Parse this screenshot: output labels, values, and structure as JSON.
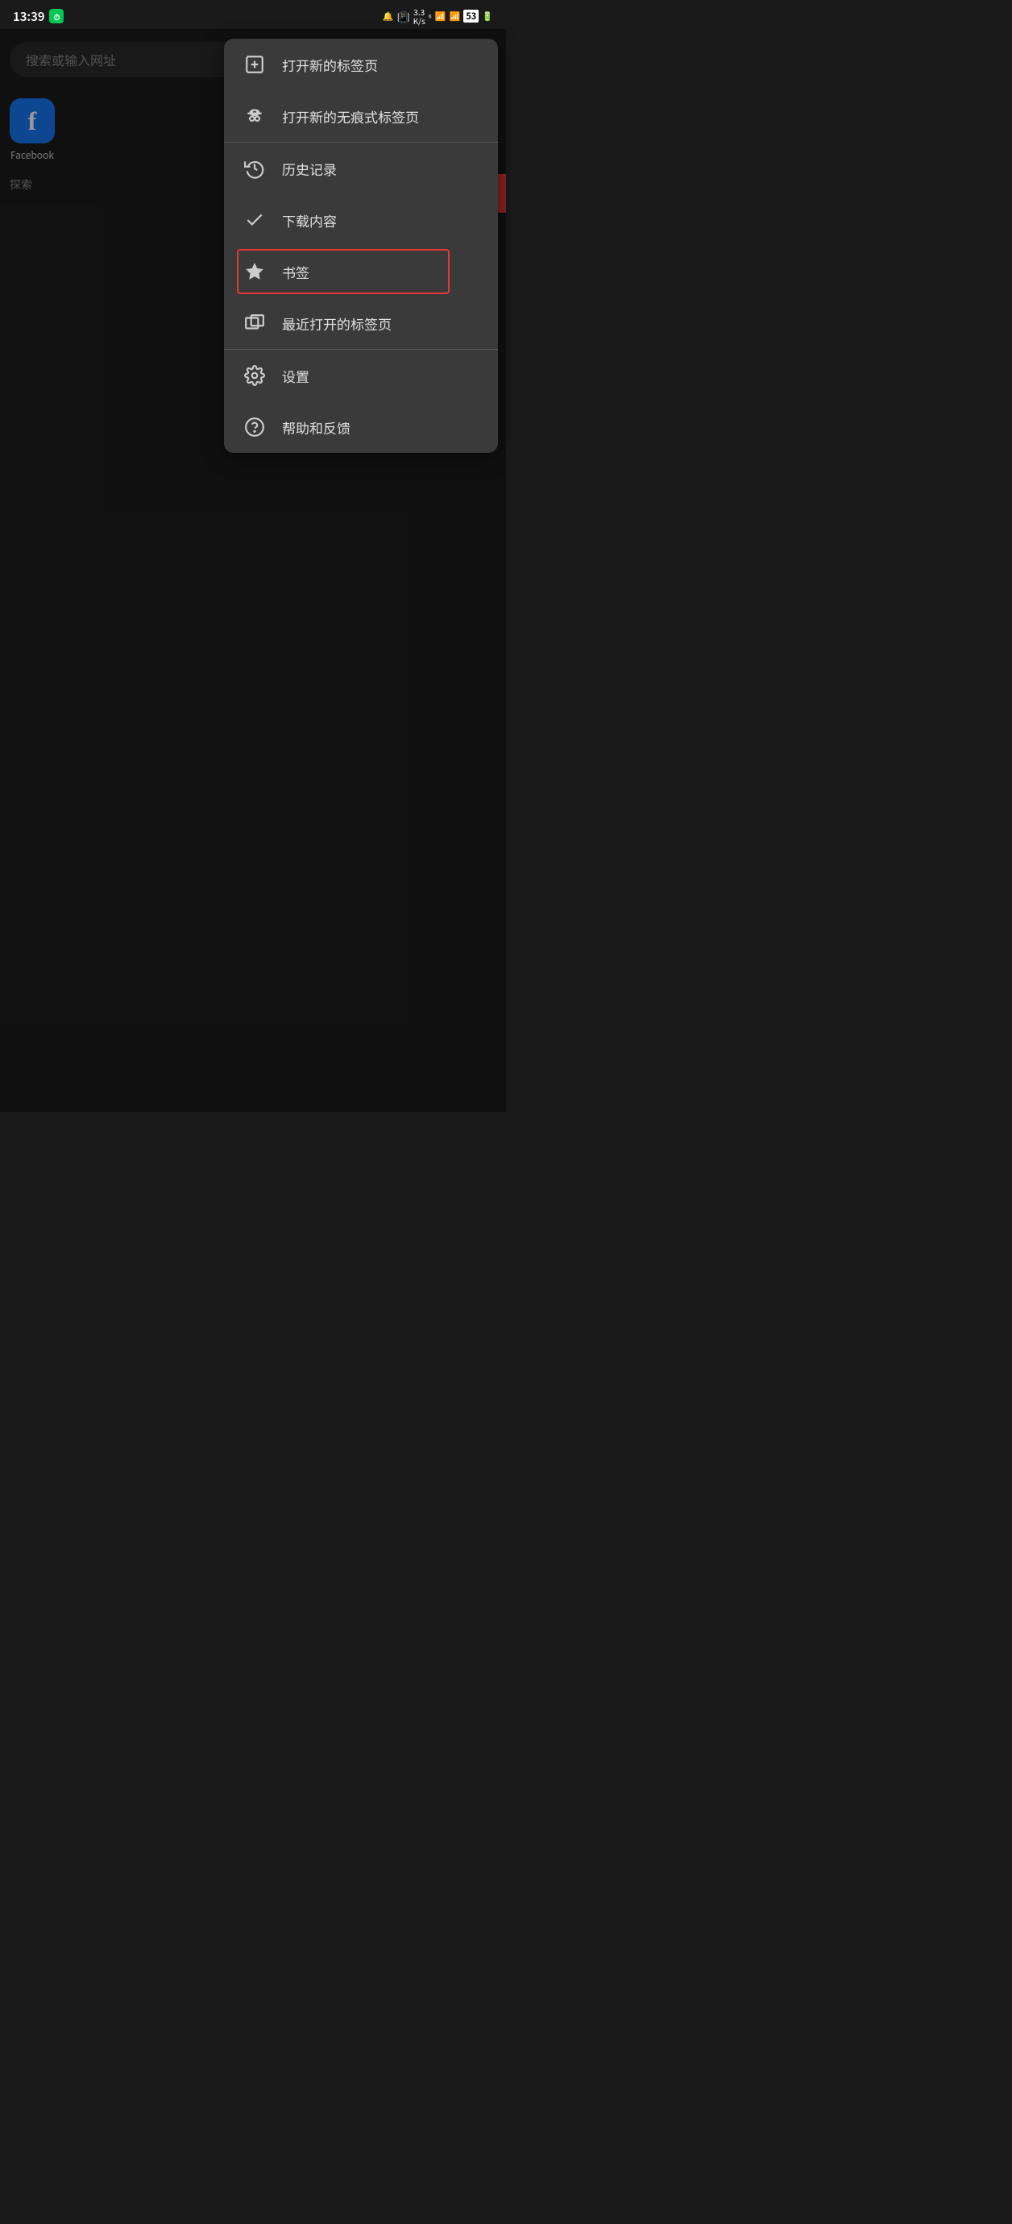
{
  "statusBar": {
    "time": "13:39",
    "timerIcon": "⏱",
    "rightIcons": [
      "🔔",
      "振动",
      "3.3\nK/s",
      "6",
      "WiFi",
      "信号",
      "53",
      "电量"
    ]
  },
  "searchBar": {
    "placeholder": "搜索或输入网址"
  },
  "shortcuts": [
    {
      "label": "Facebook",
      "iconLetter": "f",
      "iconBg": "#1877f2"
    }
  ],
  "exploreLabel": "探索",
  "menu": {
    "items": [
      {
        "id": "new-tab",
        "label": "打开新的标签页",
        "iconType": "new-tab"
      },
      {
        "id": "incognito-tab",
        "label": "打开新的无痕式标签页",
        "iconType": "incognito",
        "dividerAfter": false
      },
      {
        "id": "history",
        "label": "历史记录",
        "iconType": "history",
        "dividerBefore": true
      },
      {
        "id": "downloads",
        "label": "下载内容",
        "iconType": "download"
      },
      {
        "id": "bookmarks",
        "label": "书签",
        "iconType": "bookmark",
        "highlighted": true
      },
      {
        "id": "recent-tabs",
        "label": "最近打开的标签页",
        "iconType": "recent-tabs",
        "dividerAfter": true
      },
      {
        "id": "settings",
        "label": "设置",
        "iconType": "settings"
      },
      {
        "id": "help",
        "label": "帮助和反馈",
        "iconType": "help"
      }
    ]
  }
}
